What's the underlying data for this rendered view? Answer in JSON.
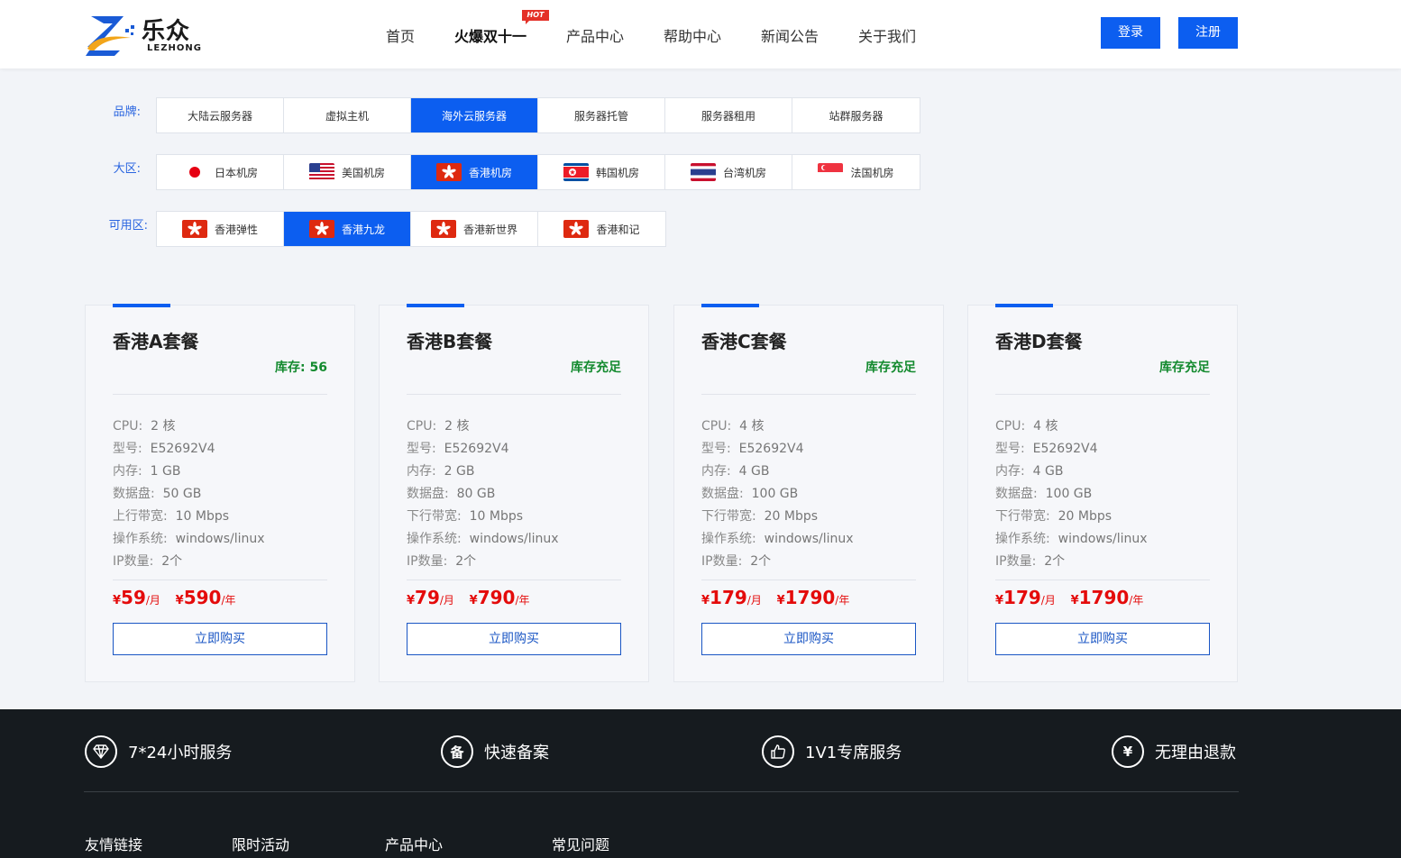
{
  "header": {
    "logo_cn": "乐众",
    "logo_en": "LEZHONG",
    "nav": [
      "首页",
      "火爆双十一",
      "产品中心",
      "帮助中心",
      "新闻公告",
      "关于我们"
    ],
    "hot_badge": "HOT",
    "login": "登录",
    "register": "注册"
  },
  "filters": {
    "brand_label": "品牌:",
    "brand": [
      "大陆云服务器",
      "虚拟主机",
      "海外云服务器",
      "服务器托管",
      "服务器租用",
      "站群服务器"
    ],
    "brand_active": 2,
    "region_label": "大区:",
    "region": [
      "日本机房",
      "美国机房",
      "香港机房",
      "韩国机房",
      "台湾机房",
      "法国机房"
    ],
    "region_active": 2,
    "zone_label": "可用区:",
    "zone": [
      "香港弹性",
      "香港九龙",
      "香港新世界",
      "香港和记"
    ],
    "zone_active": 1
  },
  "plans": [
    {
      "title": "香港A套餐",
      "stock": "库存:  56",
      "cpu_k": "CPU:",
      "cpu": "2 核",
      "model_k": "型号:",
      "model": "E52692V4",
      "mem_k": "内存:",
      "mem": "1 GB",
      "disk_k": "数据盘:",
      "disk": "50 GB",
      "bw_k": "上行带宽:",
      "bw": "10 Mbps",
      "os_k": "操作系统:",
      "os": "windows/linux",
      "ip_k": "IP数量:",
      "ip": "2个",
      "cur": "¥",
      "month": "59",
      "month_unit": "/月",
      "year": "590",
      "year_unit": "/年",
      "buy": "立即购买"
    },
    {
      "title": "香港B套餐",
      "stock": "库存充足",
      "cpu_k": "CPU:",
      "cpu": "2 核",
      "model_k": "型号:",
      "model": "E52692V4",
      "mem_k": "内存:",
      "mem": "2 GB",
      "disk_k": "数据盘:",
      "disk": "80 GB",
      "bw_k": "下行带宽:",
      "bw": "10 Mbps",
      "os_k": "操作系统:",
      "os": "windows/linux",
      "ip_k": "IP数量:",
      "ip": "2个",
      "cur": "¥",
      "month": "79",
      "month_unit": "/月",
      "year": "790",
      "year_unit": "/年",
      "buy": "立即购买"
    },
    {
      "title": "香港C套餐",
      "stock": "库存充足",
      "cpu_k": "CPU:",
      "cpu": "4 核",
      "model_k": "型号:",
      "model": "E52692V4",
      "mem_k": "内存:",
      "mem": "4 GB",
      "disk_k": "数据盘:",
      "disk": "100 GB",
      "bw_k": "下行带宽:",
      "bw": "20 Mbps",
      "os_k": "操作系统:",
      "os": "windows/linux",
      "ip_k": "IP数量:",
      "ip": "2个",
      "cur": "¥",
      "month": "179",
      "month_unit": "/月",
      "year": "1790",
      "year_unit": "/年",
      "buy": "立即购买"
    },
    {
      "title": "香港D套餐",
      "stock": "库存充足",
      "cpu_k": "CPU:",
      "cpu": "4 核",
      "model_k": "型号:",
      "model": "E52692V4",
      "mem_k": "内存:",
      "mem": "4 GB",
      "disk_k": "数据盘:",
      "disk": "100 GB",
      "bw_k": "下行带宽:",
      "bw": "20 Mbps",
      "os_k": "操作系统:",
      "os": "windows/linux",
      "ip_k": "IP数量:",
      "ip": "2个",
      "cur": "¥",
      "month": "179",
      "month_unit": "/月",
      "year": "1790",
      "year_unit": "/年",
      "buy": "立即购买"
    }
  ],
  "footer": {
    "features": [
      {
        "icon": "diamond-icon",
        "text": "7*24小时服务"
      },
      {
        "icon": "record-icon",
        "glyph": "备",
        "text": "快速备案"
      },
      {
        "icon": "thumbs-up-icon",
        "text": "1V1专席服务"
      },
      {
        "icon": "yen-icon",
        "glyph": "¥",
        "text": "无理由退款"
      }
    ],
    "links": [
      "友情链接",
      "限时活动",
      "产品中心",
      "常见问题"
    ]
  },
  "colors": {
    "accent": "#0c5ef0",
    "price": "#e40b0b",
    "stock": "#138a2e",
    "footer": "#161b1f"
  }
}
